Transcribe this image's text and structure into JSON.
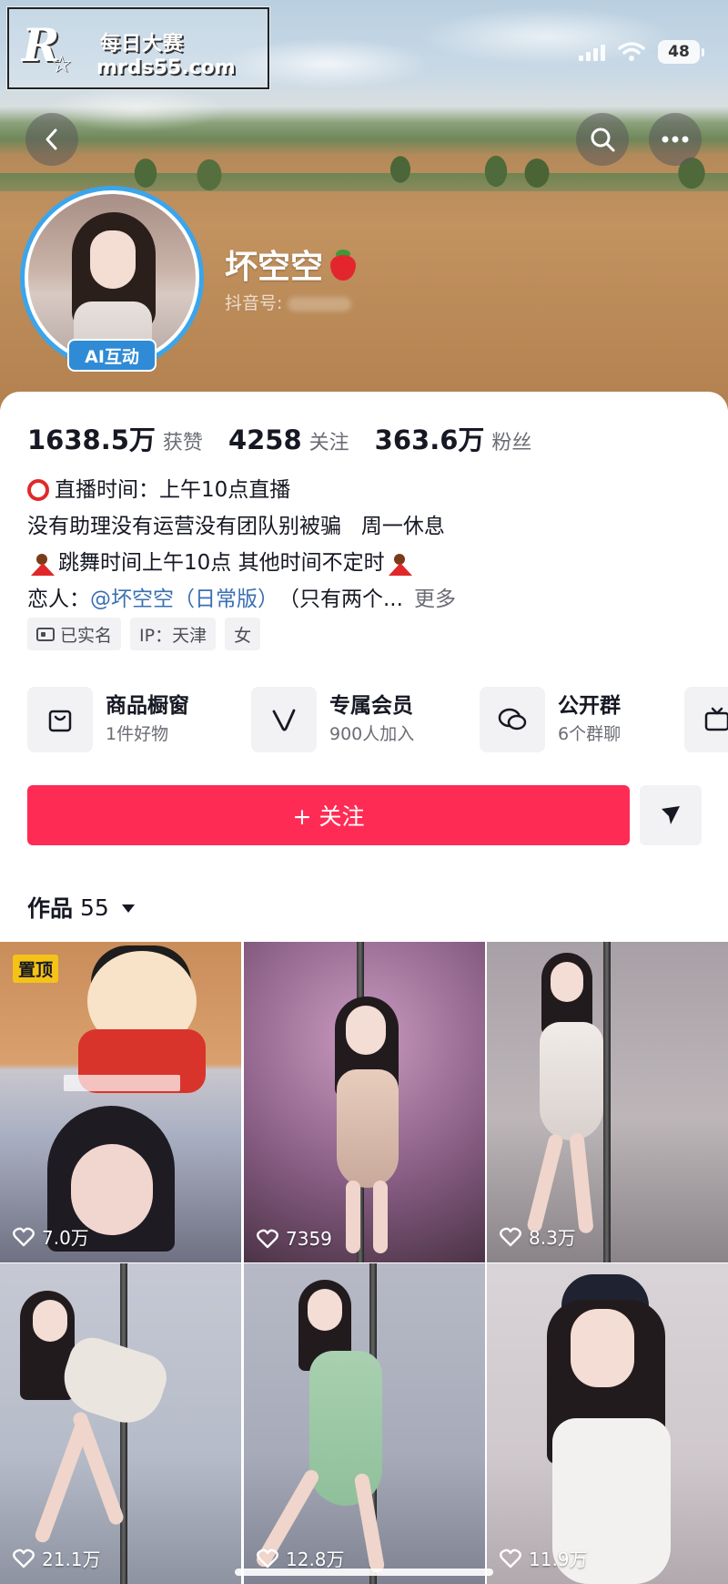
{
  "watermark": {
    "title": "每日大赛",
    "url": "mrds55.com",
    "logo_letter": "R"
  },
  "status_bar": {
    "battery": "48"
  },
  "profile": {
    "name": "坏空空",
    "douyin_id_label": "抖音号:",
    "ai_badge": "AI互动"
  },
  "stats": [
    {
      "value": "1638.5万",
      "label": "获赞"
    },
    {
      "value": "4258",
      "label": "关注"
    },
    {
      "value": "363.6万",
      "label": "粉丝"
    }
  ],
  "bio": {
    "line1": "直播时间：上午10点直播",
    "line2": "没有助理没有运营没有团队别被骗   周一休息",
    "line3": "跳舞时间上午10点 其他时间不定时",
    "line4_prefix": "恋人：",
    "line4_mention": "@坏空空（日常版）",
    "line4_suffix": "（只有两个...",
    "more": "更多"
  },
  "tags": [
    {
      "label": "已实名",
      "icon": "id-card-icon"
    },
    {
      "label": "IP：天津"
    },
    {
      "label": "女"
    }
  ],
  "features": [
    {
      "title": "商品橱窗",
      "sub": "1件好物",
      "icon": "shopping-bag-icon"
    },
    {
      "title": "专属会员",
      "sub": "900人加入",
      "icon": "v-member-icon"
    },
    {
      "title": "公开群",
      "sub": "6个群聊",
      "icon": "chat-bubbles-icon"
    },
    {
      "title": "",
      "sub": "",
      "icon": "tv-icon"
    }
  ],
  "actions": {
    "follow": "+ 关注"
  },
  "works": {
    "label": "作品",
    "count": "55"
  },
  "videos": [
    {
      "likes": "7.0万",
      "pinned": "置顶"
    },
    {
      "likes": "7359"
    },
    {
      "likes": "8.3万"
    },
    {
      "likes": "21.1万"
    },
    {
      "likes": "12.8万"
    },
    {
      "likes": "11.9万"
    }
  ],
  "colors": {
    "accent": "#fe2c55",
    "avatar_ring": "#3aa5ec",
    "mention": "#3a6fb3",
    "pin": "#f5c218"
  }
}
